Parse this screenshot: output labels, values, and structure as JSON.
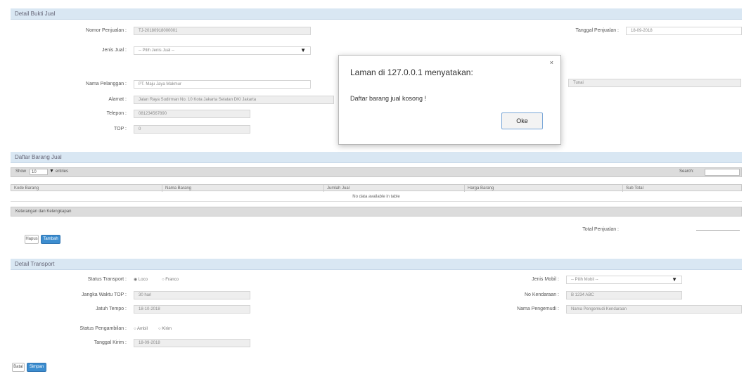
{
  "section_data_penjualan": {
    "header": "Detail Bukti Jual",
    "fields": {
      "nomor_penjualan": {
        "label": "Nomor Penjualan :",
        "value": "TJ-20180918000001"
      },
      "jenis_jual": {
        "label": "Jenis Jual :",
        "value": "-- Pilih Jenis Jual --"
      },
      "nama_pelanggan": {
        "label": "Nama Pelanggan :",
        "value": "PT. Maju Jaya Makmur"
      },
      "alamat": {
        "label": "Alamat :",
        "value": "Jalan Raya Sudirman No. 10 Kota Jakarta Selatan DKI Jakarta"
      },
      "telepon": {
        "label": "Telepon :",
        "value": "081234567890"
      },
      "top": {
        "label": "TOP :",
        "value": "0"
      },
      "tanggal_penjualan": {
        "label": "Tanggal Penjualan :",
        "value": "18-09-2018"
      },
      "right_extra": {
        "value": "Tunai"
      }
    }
  },
  "section_daftar_barang": {
    "header": "Daftar Barang Jual",
    "toolbar": {
      "show_label": "Show",
      "show_value": "10",
      "entries_label": "entries",
      "search_label": "Search:"
    },
    "columns": [
      "Kode Barang",
      "Nama Barang",
      "Jumlah Jual",
      "Harga Barang",
      "Sub Total"
    ],
    "empty_message": "No data available in table",
    "footer_bar": "Keterangan dan Kelengkapan",
    "footer_right": "",
    "total_label": "Total Penjualan :",
    "buttons": {
      "hapus": "Hapus",
      "tambah": "Tambah"
    }
  },
  "section_transport": {
    "header": "Detail Transport",
    "fields": {
      "status_transport": {
        "label": "Status Transport :",
        "options": [
          "Loco",
          "Franco"
        ]
      },
      "jangka_waktu": {
        "label": "Jangka Waktu TOP :",
        "value": "30 hari"
      },
      "jatuh_tempo": {
        "label": "Jatuh Tempo :",
        "value": "18-10-2018"
      },
      "status_pengambilan": {
        "label": "Status Pengambilan :",
        "options": [
          "Ambil",
          "Kirim"
        ]
      },
      "tanggal_kirim": {
        "label": "Tanggal Kirim :",
        "value": "18-09-2018"
      },
      "jenis_mobil": {
        "label": "Jenis Mobil :",
        "value": "-- Pilih Mobil --"
      },
      "no_kendaraan": {
        "label": "No Kendaraan :",
        "value": "B 1234 ABC"
      },
      "nama_pengemudi": {
        "label": "Nama Pengemudi :",
        "value": "Nama Pengemudi Kendaraan"
      }
    }
  },
  "bottom_buttons": {
    "batal": "Batal",
    "simpan": "Simpan"
  },
  "dialog": {
    "title": "Laman di 127.0.0.1 menyatakan:",
    "message": "Daftar barang jual kosong !",
    "ok": "Oke",
    "close": "×"
  },
  "colors": {
    "accent": "#3c8dcf",
    "panel_header": "#d9e7f3",
    "field_bg": "#eeeeee"
  }
}
